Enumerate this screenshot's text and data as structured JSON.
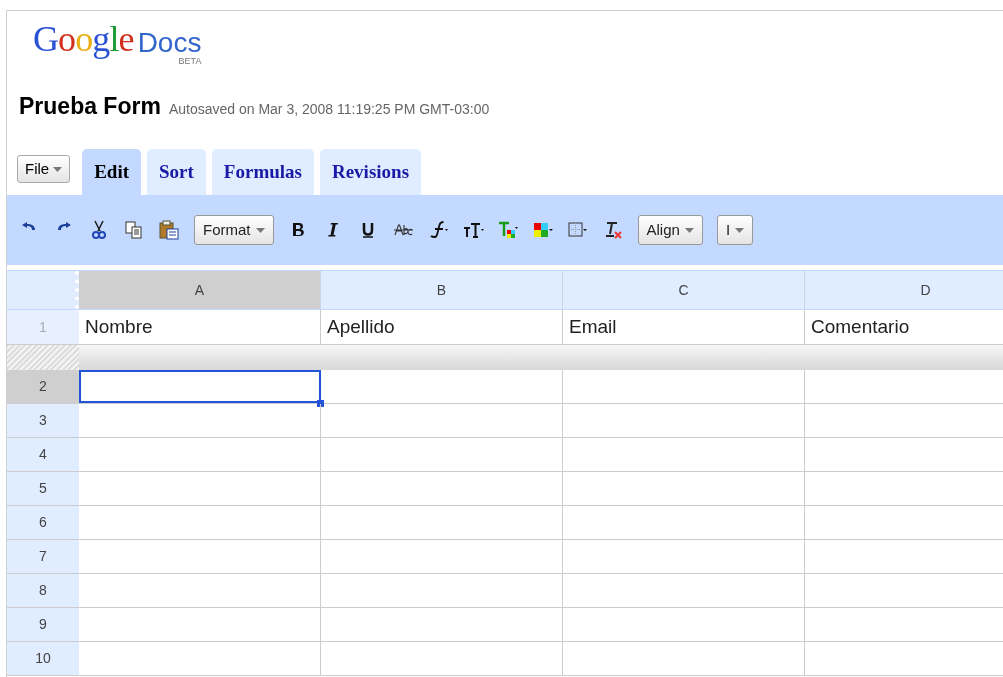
{
  "logo": {
    "wordmark": "Google",
    "product": "Docs",
    "badge": "BETA"
  },
  "document": {
    "title": "Prueba Form",
    "status": "Autosaved on Mar 3, 2008 11:19:25 PM GMT-03:00"
  },
  "menu_button": {
    "label": "File"
  },
  "tabs": [
    {
      "label": "Edit",
      "selected": true
    },
    {
      "label": "Sort",
      "selected": false
    },
    {
      "label": "Formulas",
      "selected": false
    },
    {
      "label": "Revisions",
      "selected": false
    }
  ],
  "toolbar": [
    {
      "kind": "undo"
    },
    {
      "kind": "redo"
    },
    {
      "kind": "cut"
    },
    {
      "kind": "copy"
    },
    {
      "kind": "paste"
    },
    {
      "kind": "dropdown",
      "label": "Format"
    },
    {
      "kind": "bold"
    },
    {
      "kind": "italic"
    },
    {
      "kind": "underline"
    },
    {
      "kind": "strike"
    },
    {
      "kind": "font"
    },
    {
      "kind": "size"
    },
    {
      "kind": "textcolor"
    },
    {
      "kind": "fillcolor"
    },
    {
      "kind": "borders"
    },
    {
      "kind": "clear"
    },
    {
      "kind": "dropdown",
      "label": "Align"
    },
    {
      "kind": "dropdown",
      "label": "I"
    }
  ],
  "grid": {
    "columns": [
      {
        "label": "A",
        "selected": true
      },
      {
        "label": "B",
        "selected": false
      },
      {
        "label": "C",
        "selected": false
      },
      {
        "label": "D",
        "selected": false
      }
    ],
    "frozen_row": {
      "number": "1",
      "cells": [
        "Nombre",
        "Apellido",
        "Email",
        "Comentario"
      ]
    },
    "rows": [
      {
        "number": "2",
        "selected": true,
        "cells": [
          {
            "selected": true
          },
          {
            "selected": false
          },
          {
            "selected": false
          },
          {
            "selected": false
          }
        ]
      },
      {
        "number": "3",
        "selected": false
      },
      {
        "number": "4",
        "selected": false
      },
      {
        "number": "5",
        "selected": false
      },
      {
        "number": "6",
        "selected": false
      },
      {
        "number": "7",
        "selected": false
      },
      {
        "number": "8",
        "selected": false
      },
      {
        "number": "9",
        "selected": false
      },
      {
        "number": "10",
        "selected": false
      }
    ]
  }
}
